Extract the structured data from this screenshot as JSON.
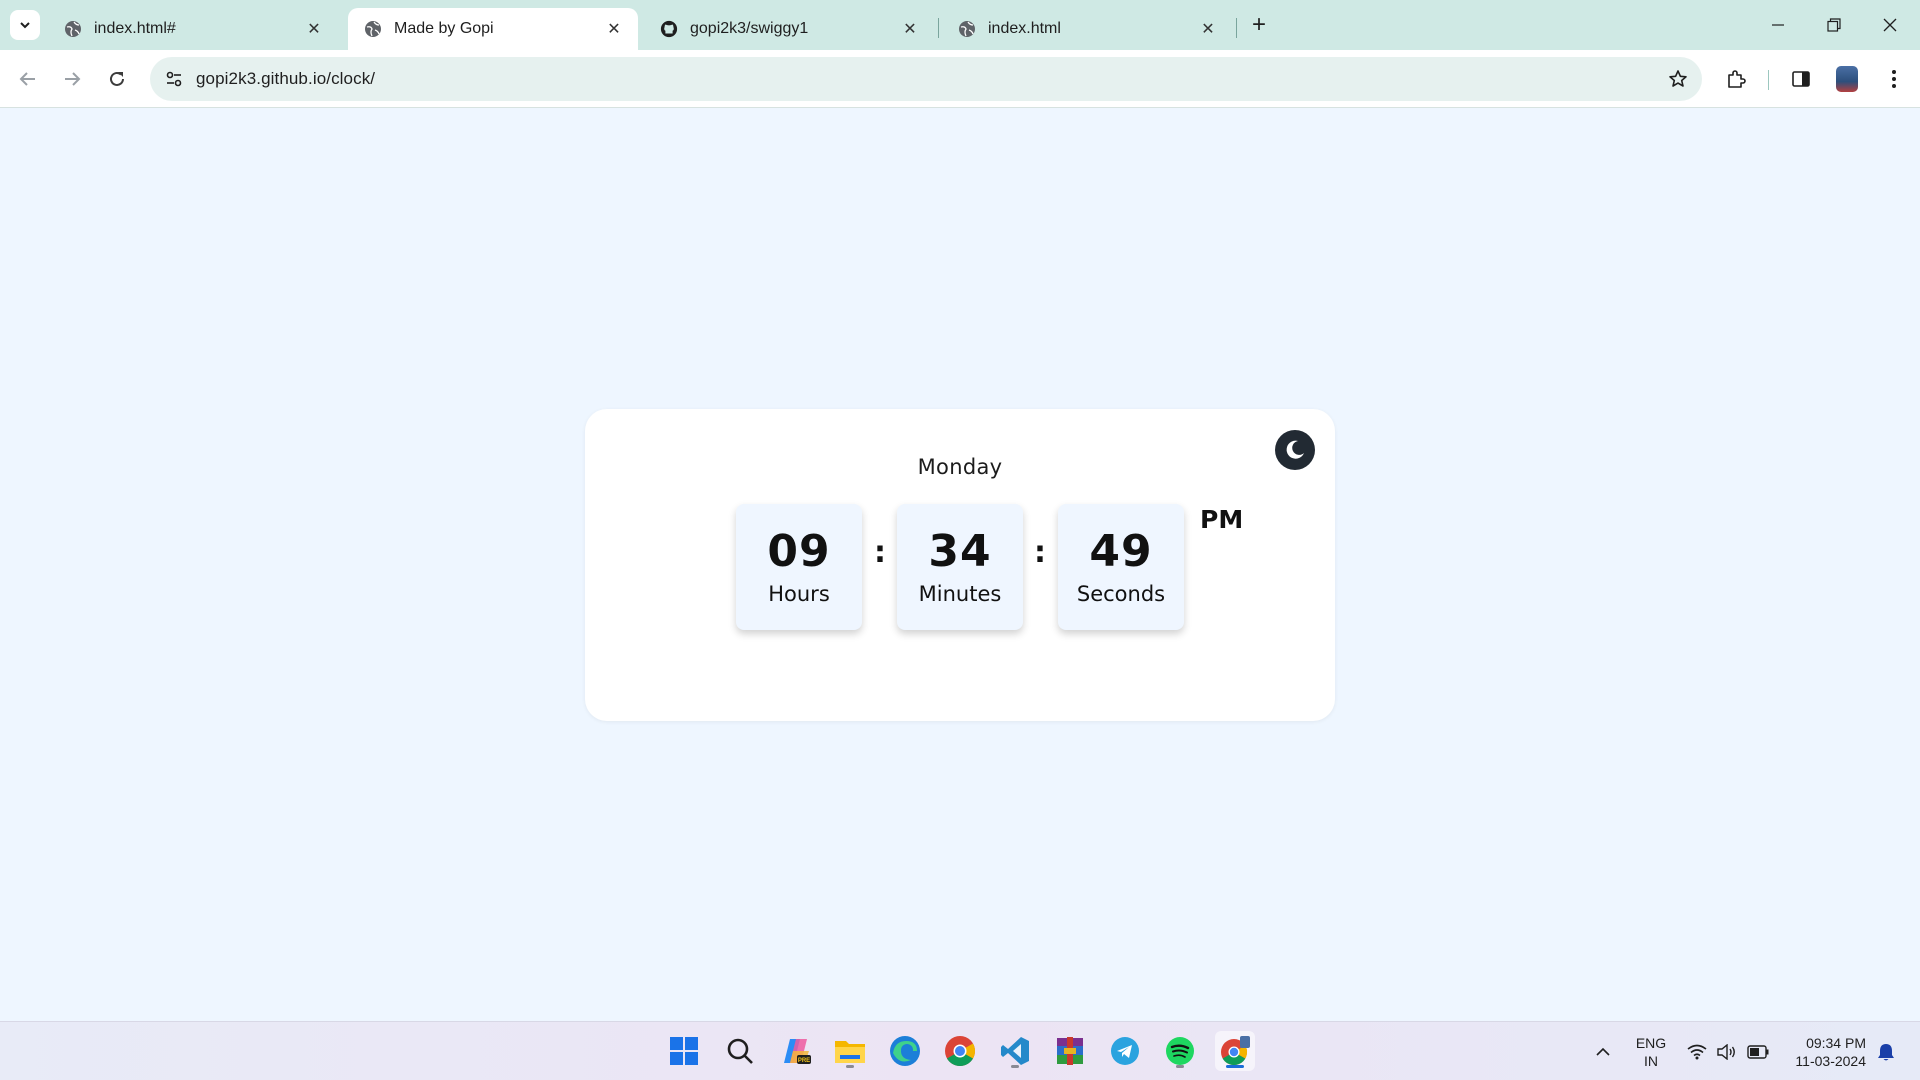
{
  "browser": {
    "tabs": [
      {
        "title": "index.html#",
        "active": false
      },
      {
        "title": "Made by Gopi",
        "active": true
      },
      {
        "title": "gopi2k3/swiggy1",
        "active": false
      },
      {
        "title": "index.html",
        "active": false
      }
    ],
    "url": "gopi2k3.github.io/clock/"
  },
  "clock": {
    "day": "Monday",
    "hours": "09",
    "hours_label": "Hours",
    "minutes": "34",
    "minutes_label": "Minutes",
    "seconds": "49",
    "seconds_label": "Seconds",
    "separator": ":",
    "period": "PM"
  },
  "taskbar": {
    "apps": [
      "start-icon",
      "search-icon",
      "copilot-icon",
      "file-explorer-icon",
      "edge-icon",
      "chrome-icon",
      "vscode-icon",
      "winrar-icon",
      "telegram-icon",
      "spotify-icon",
      "chrome-profile-icon"
    ],
    "language": "ENG",
    "region": "IN",
    "time": "09:34 PM",
    "date": "11-03-2024"
  },
  "colors": {
    "page_background": "#eef6ff",
    "card_background": "#ffffff",
    "time_box_background": "#eff6ff",
    "tabstrip": "#cfe9e4",
    "accent": "#1a6dd8"
  }
}
